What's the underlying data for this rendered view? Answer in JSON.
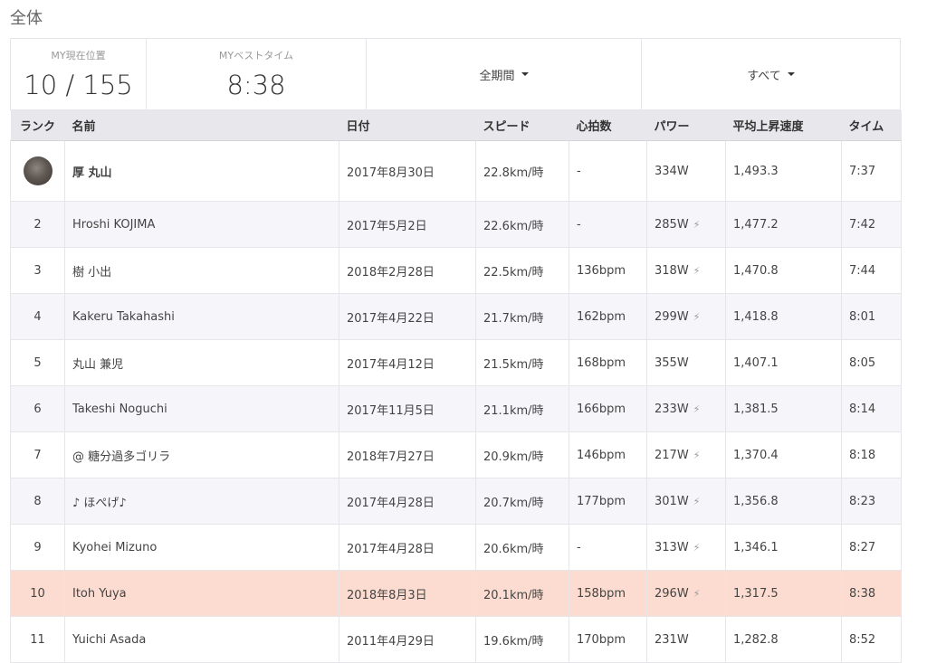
{
  "page": {
    "title": "全体"
  },
  "summary": {
    "position_label": "MY現在位置",
    "position_value": "10 / 155",
    "best_label": "MYベストタイム",
    "best_value": "8:38",
    "period_filter": "全期間",
    "scope_filter": "すべて"
  },
  "table": {
    "headers": {
      "rank": "ランク",
      "name": "名前",
      "date": "日付",
      "speed": "スピード",
      "heart_rate": "心拍数",
      "power": "パワー",
      "vam": "平均上昇速度",
      "time": "タイム"
    },
    "rows": [
      {
        "rank": "",
        "name": "厚 丸山",
        "date": "2017年8月30日",
        "speed": "22.8km/時",
        "hr": "-",
        "power": "334W",
        "estimated": false,
        "vam": "1,493.3",
        "time": "7:37",
        "avatar": true,
        "highlight": false
      },
      {
        "rank": "2",
        "name": "Hroshi KOJIMA",
        "date": "2017年5月2日",
        "speed": "22.6km/時",
        "hr": "-",
        "power": "285W",
        "estimated": true,
        "vam": "1,477.2",
        "time": "7:42",
        "avatar": false,
        "highlight": false
      },
      {
        "rank": "3",
        "name": "樹 小出",
        "date": "2018年2月28日",
        "speed": "22.5km/時",
        "hr": "136bpm",
        "power": "318W",
        "estimated": true,
        "vam": "1,470.8",
        "time": "7:44",
        "avatar": false,
        "highlight": false
      },
      {
        "rank": "4",
        "name": "Kakeru Takahashi",
        "date": "2017年4月22日",
        "speed": "21.7km/時",
        "hr": "162bpm",
        "power": "299W",
        "estimated": true,
        "vam": "1,418.8",
        "time": "8:01",
        "avatar": false,
        "highlight": false
      },
      {
        "rank": "5",
        "name": "丸山 兼児",
        "date": "2017年4月12日",
        "speed": "21.5km/時",
        "hr": "168bpm",
        "power": "355W",
        "estimated": false,
        "vam": "1,407.1",
        "time": "8:05",
        "avatar": false,
        "highlight": false
      },
      {
        "rank": "6",
        "name": "Takeshi Noguchi",
        "date": "2017年11月5日",
        "speed": "21.1km/時",
        "hr": "166bpm",
        "power": "233W",
        "estimated": true,
        "vam": "1,381.5",
        "time": "8:14",
        "avatar": false,
        "highlight": false
      },
      {
        "rank": "7",
        "name": "@ 糖分過多ゴリラ",
        "date": "2018年7月27日",
        "speed": "20.9km/時",
        "hr": "146bpm",
        "power": "217W",
        "estimated": true,
        "vam": "1,370.4",
        "time": "8:18",
        "avatar": false,
        "highlight": false
      },
      {
        "rank": "8",
        "name": "♪ ほぺげ♪",
        "date": "2017年4月28日",
        "speed": "20.7km/時",
        "hr": "177bpm",
        "power": "301W",
        "estimated": true,
        "vam": "1,356.8",
        "time": "8:23",
        "avatar": false,
        "highlight": false
      },
      {
        "rank": "9",
        "name": "Kyohei Mizuno",
        "date": "2017年4月28日",
        "speed": "20.6km/時",
        "hr": "-",
        "power": "313W",
        "estimated": true,
        "vam": "1,346.1",
        "time": "8:27",
        "avatar": false,
        "highlight": false
      },
      {
        "rank": "10",
        "name": "Itoh Yuya",
        "date": "2018年8月3日",
        "speed": "20.1km/時",
        "hr": "158bpm",
        "power": "296W",
        "estimated": true,
        "vam": "1,317.5",
        "time": "8:38",
        "avatar": false,
        "highlight": true
      },
      {
        "rank": "11",
        "name": "Yuichi Asada",
        "date": "2011年4月29日",
        "speed": "19.6km/時",
        "hr": "170bpm",
        "power": "231W",
        "estimated": false,
        "vam": "1,282.8",
        "time": "8:52",
        "avatar": false,
        "highlight": false
      }
    ]
  },
  "icons": {
    "estimated_power": "lightning-bolt-icon",
    "dropdown": "caret-down-icon"
  },
  "colors": {
    "date_link": "#2a8aa8",
    "my_row": "#fcdcd0",
    "header_bg": "#e8e8ec",
    "alt_row": "#f6f6fa"
  }
}
